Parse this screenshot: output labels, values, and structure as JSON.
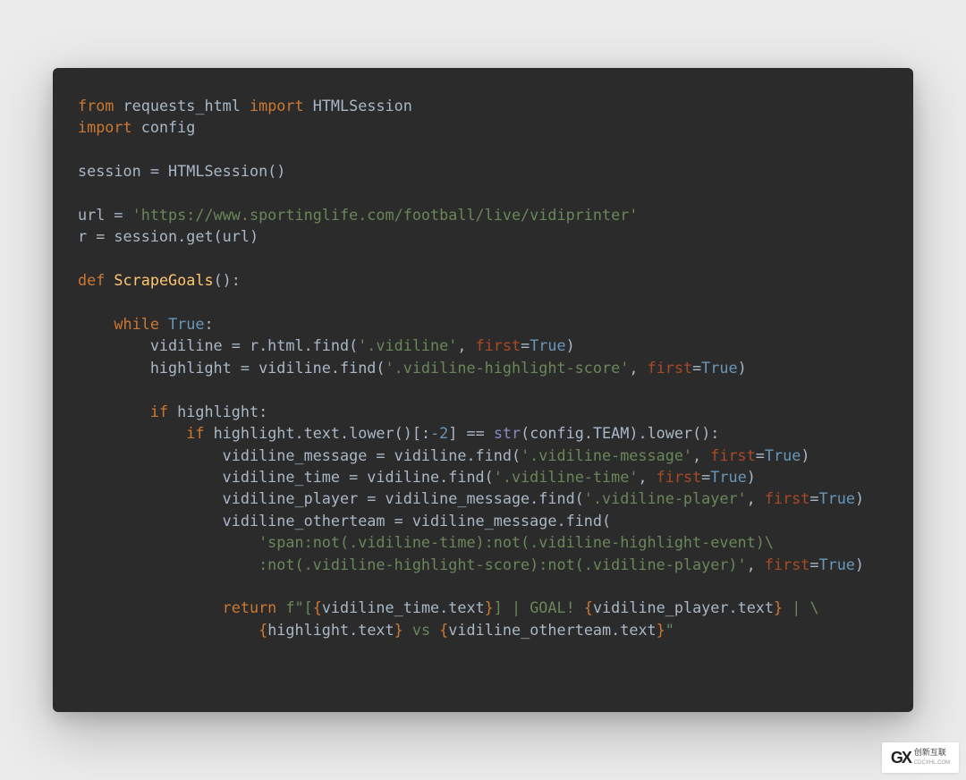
{
  "code": {
    "l1_from": "from",
    "l1_mod": "requests_html",
    "l1_import": "import",
    "l1_name": "HTMLSession",
    "l2_import": "import",
    "l2_mod": "config",
    "l4": "session = HTMLSession()",
    "l6_a": "url = ",
    "l6_str": "'https://www.sportinglife.com/football/live/vidiprinter'",
    "l7": "r = session.get(url)",
    "l9_def": "def",
    "l9_name": "ScrapeGoals",
    "l9_tail": "():",
    "l11_while": "while",
    "l11_true": "True",
    "l11_colon": ":",
    "l12_a": "vidiline = r.html.find(",
    "l12_str": "'.vidiline'",
    "l12_b": ", ",
    "l12_param": "first",
    "l12_eq": "=",
    "l12_true": "True",
    "l12_end": ")",
    "l13_a": "highlight = vidiline.find(",
    "l13_str": "'.vidiline-highlight-score'",
    "l13_b": ", ",
    "l13_param": "first",
    "l13_eq": "=",
    "l13_true": "True",
    "l13_end": ")",
    "l15_if": "if",
    "l15_rest": " highlight:",
    "l16_if": "if",
    "l16_a": " highlight.text.lower()[:",
    "l16_num": "-2",
    "l16_b": "] == ",
    "l16_str": "str",
    "l16_c": "(config.TEAM).lower():",
    "l17_a": "vidiline_message = vidiline.find(",
    "l17_str": "'.vidiline-message'",
    "l17_b": ", ",
    "l17_param": "first",
    "l17_eq": "=",
    "l17_true": "True",
    "l17_end": ")",
    "l18_a": "vidiline_time = vidiline.find(",
    "l18_str": "'.vidiline-time'",
    "l18_b": ", ",
    "l18_param": "first",
    "l18_eq": "=",
    "l18_true": "True",
    "l18_end": ")",
    "l19_a": "vidiline_player = vidiline_message.find(",
    "l19_str": "'.vidiline-player'",
    "l19_b": ", ",
    "l19_param": "first",
    "l19_eq": "=",
    "l19_true": "True",
    "l19_end": ")",
    "l20": "vidiline_otherteam = vidiline_message.find(",
    "l21_str": "'span:not(.vidiline-time):not(.vidiline-highlight-event)",
    "l21_esc": "\\",
    "l22_str": "                    :not(.vidiline-highlight-score):not(.vidiline-player)'",
    "l22_b": ", ",
    "l22_param": "first",
    "l22_eq": "=",
    "l22_true": "True",
    "l22_end": ")",
    "l24_ret": "return",
    "l24_f": "f\"[",
    "l24_e1": "vidiline_time.text",
    "l24_m1": "] | GOAL! ",
    "l24_e2": "vidiline_player.text",
    "l24_m2": " | ",
    "l24_esc": "\\",
    "l25_sp": "                    ",
    "l25_e3": "highlight.text",
    "l25_m3": " vs ",
    "l25_e4": "vidiline_otherteam.text",
    "l25_end": "\""
  },
  "watermark": {
    "logo": "GX",
    "text1": "创新互联",
    "text2": "CDCXHL.COM"
  }
}
